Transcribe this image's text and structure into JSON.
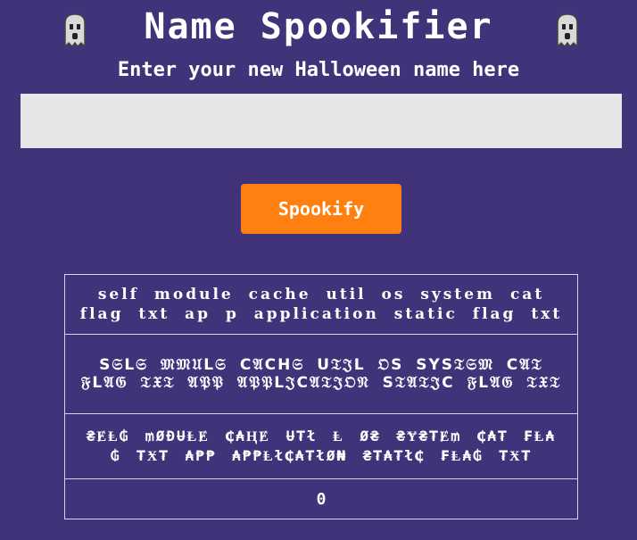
{
  "header": {
    "title": "Name Spookifier",
    "ghost_icon": "ghost-icon"
  },
  "subtitle": "Enter your new Halloween name here",
  "input": {
    "value": "",
    "placeholder": ""
  },
  "button": {
    "label": "Spookify"
  },
  "results": [
    "self module cache util os system cat flag txt ap p application static flag txt",
    "S𝔖L𝔖 𝔐𝔐𝔘L𝔖 C𝔄CH𝔖 U𝔗𝔍L 𝔒S SYS𝔗𝔖𝔐 C𝔄𝔗 𝔉L𝔄𝔊 𝔗𝔛𝔗 𝔄𝔓𝔓 𝔄𝔓𝔓L𝔍C𝔄𝔗𝔍𝔒𝔑 S𝔗𝔄𝔗𝔍C 𝔉L𝔄𝔊 𝔗𝔛𝔗",
    "₴ɆⱠ₲ ₥ØĐɄⱠɆ ₵₳ⱧɆ Ʉ₮ł Ⱡ Ø₴ ₴Ɏ₴₮Ɇ₥ ₵₳₮ ₣Ⱡ₳ ₲ ₮Ӿ₮ ₳₱₱ ₳₱₱Ⱡł₵₳₮łØ₦ ₴₮₳₮ł₵ ₣Ⱡ₳₲ ₮Ӿ₮",
    "0"
  ],
  "colors": {
    "background": "#41337A",
    "input_bg": "#E6E6E6",
    "button_bg": "#FF7F11",
    "text": "#FFFFFF"
  }
}
